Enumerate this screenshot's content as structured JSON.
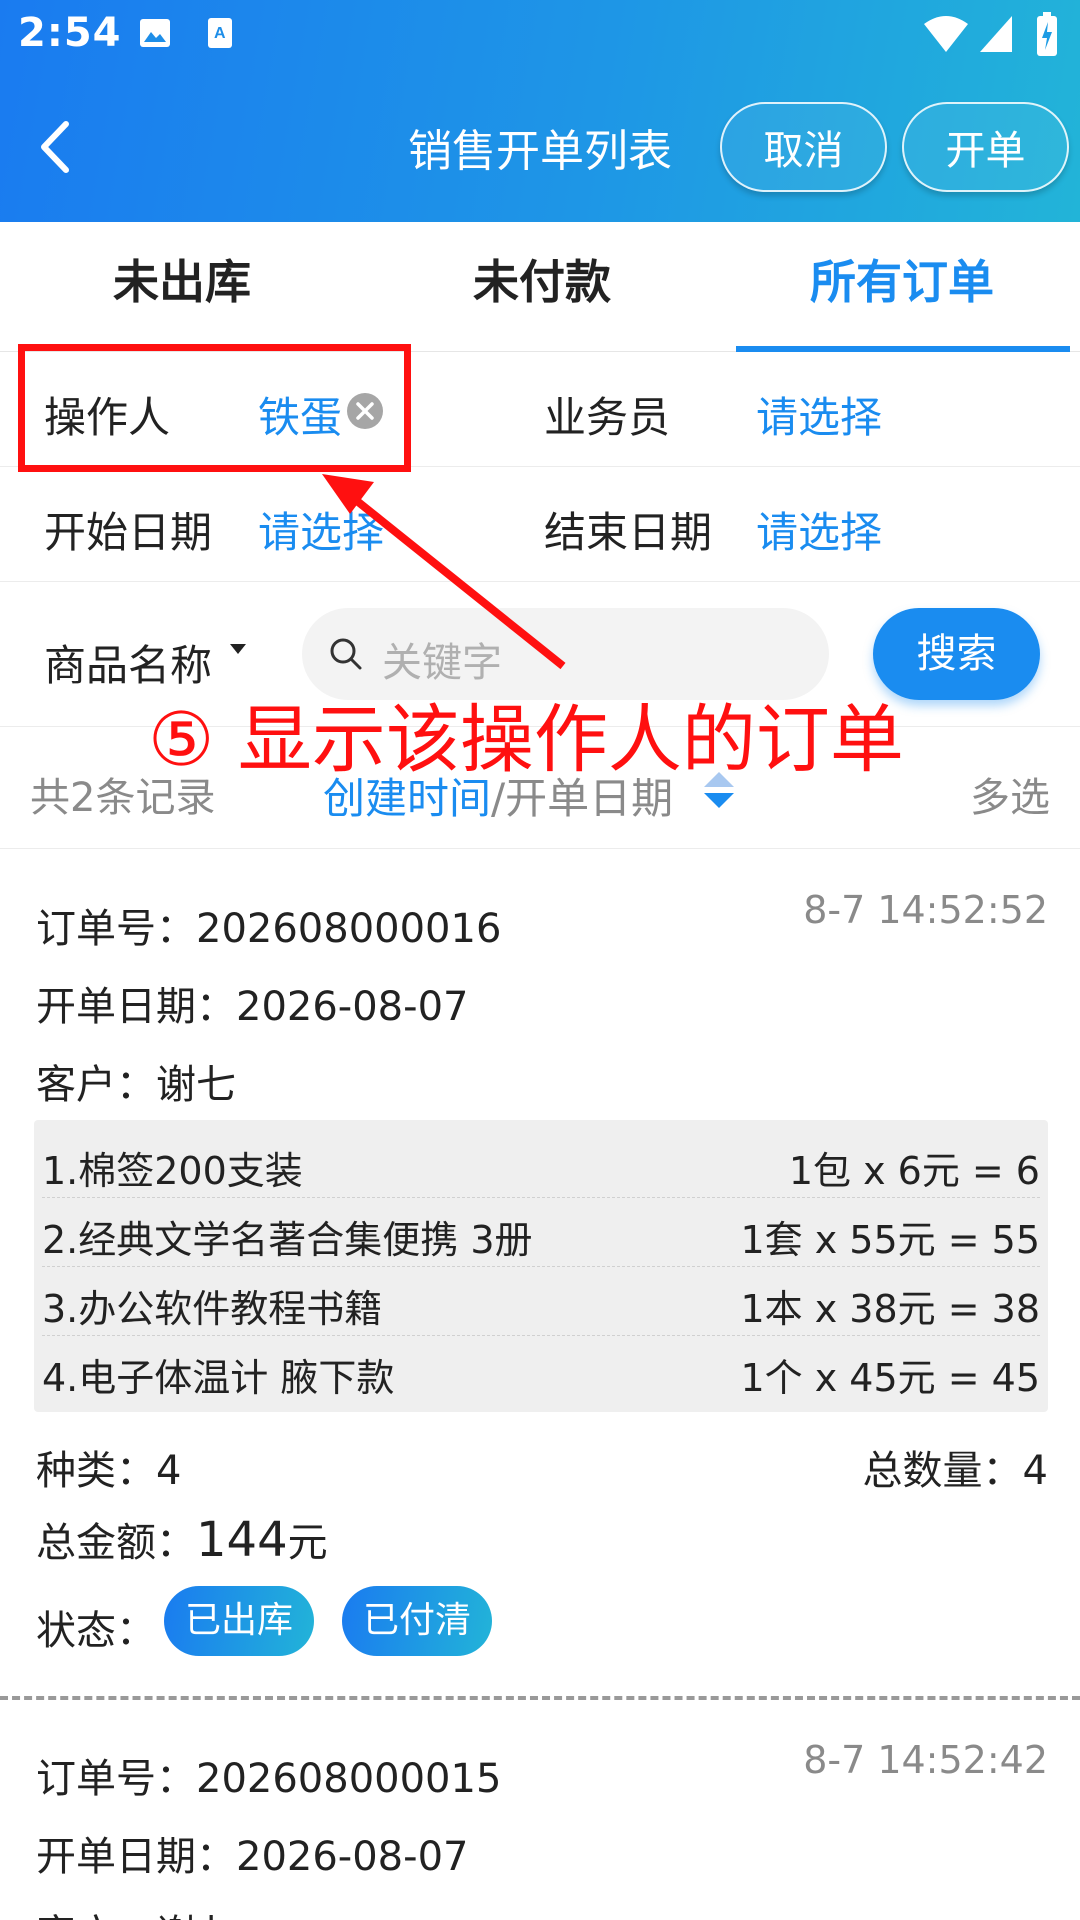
{
  "status_bar": {
    "time": "2:54"
  },
  "nav": {
    "title": "销售开单列表",
    "cancel": "取消",
    "create": "开单"
  },
  "tabs": [
    {
      "label": "未出库"
    },
    {
      "label": "未付款"
    },
    {
      "label": "所有订单"
    }
  ],
  "filters": {
    "operator_label": "操作人",
    "operator_value": "铁蛋",
    "salesman_label": "业务员",
    "salesman_value": "请选择",
    "start_label": "开始日期",
    "start_value": "请选择",
    "end_label": "结束日期",
    "end_value": "请选择"
  },
  "search": {
    "field_select": "商品名称",
    "placeholder": "关键字",
    "button": "搜索"
  },
  "summary": {
    "count": "共2条记录",
    "sort_created": "创建时间",
    "sort_sep": "/",
    "sort_date": "开单日期",
    "multi_select": "多选"
  },
  "orders": [
    {
      "order_no_label": "订单号：",
      "order_no": "202608000016",
      "time": "8-7 14:52:52",
      "date_label": "开单日期：",
      "date": "2026-08-07",
      "customer_label": "客户：",
      "customer": "谢七",
      "items": [
        {
          "name": "1.棉签200支装",
          "calc": "1包 x 6元 = 6"
        },
        {
          "name": "2.经典文学名著合集便携 3册",
          "calc": "1套 x 55元 = 55"
        },
        {
          "name": "3.办公软件教程书籍",
          "calc": "1本 x 38元 = 38"
        },
        {
          "name": "4.电子体温计 腋下款",
          "calc": "1个 x 45元 = 45"
        }
      ],
      "kinds_label": "种类：",
      "kinds": "4",
      "qty_label": "总数量：",
      "qty": "4",
      "amount_label": "总金额：",
      "amount": "144",
      "amount_unit": "元",
      "status_label": "状态：",
      "status_out": "已出库",
      "status_paid": "已付清"
    },
    {
      "order_no_label": "订单号：",
      "order_no": "202608000015",
      "time": "8-7 14:52:42",
      "date_label": "开单日期：",
      "date": "2026-08-07",
      "customer_label": "客户：",
      "customer": "谢七"
    }
  ],
  "annotation": {
    "text": "⑤ 显示该操作人的订单"
  },
  "colors": {
    "accent": "#1a8cf0",
    "annotation": "#ff1010",
    "header_start": "#1a7bf0",
    "header_end": "#22b4d8"
  }
}
